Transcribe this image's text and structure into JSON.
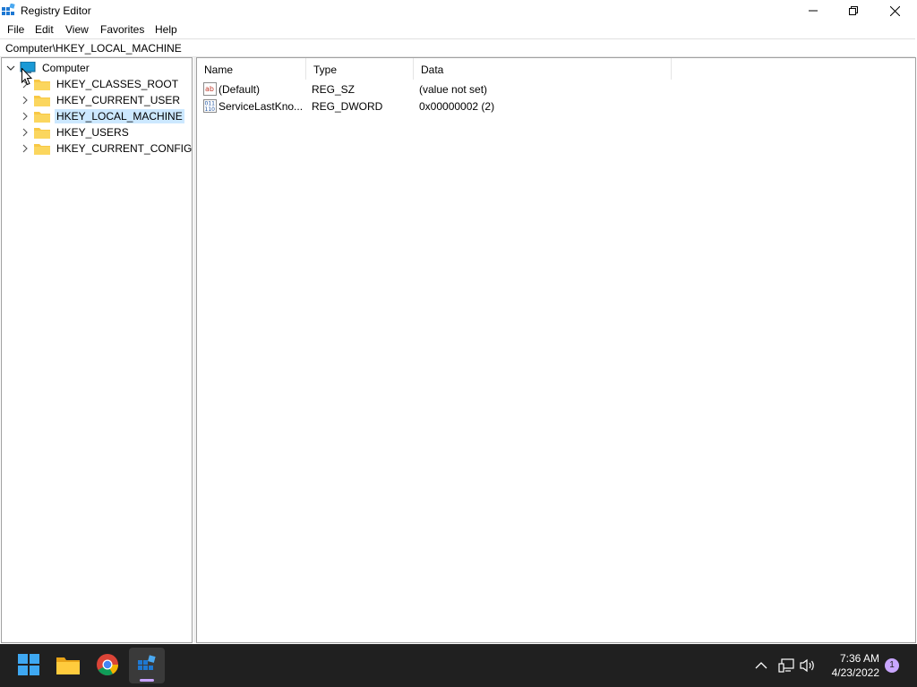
{
  "window": {
    "title": "Registry Editor"
  },
  "menu": [
    "File",
    "Edit",
    "View",
    "Favorites",
    "Help"
  ],
  "address": "Computer\\HKEY_LOCAL_MACHINE",
  "tree": {
    "root": "Computer",
    "items": [
      {
        "label": "HKEY_CLASSES_ROOT",
        "selected": false
      },
      {
        "label": "HKEY_CURRENT_USER",
        "selected": false
      },
      {
        "label": "HKEY_LOCAL_MACHINE",
        "selected": true
      },
      {
        "label": "HKEY_USERS",
        "selected": false
      },
      {
        "label": "HKEY_CURRENT_CONFIG",
        "selected": false
      }
    ]
  },
  "list": {
    "columns": [
      "Name",
      "Type",
      "Data"
    ],
    "rows": [
      {
        "icon": "string-value-icon",
        "name": "(Default)",
        "type": "REG_SZ",
        "data": "(value not set)"
      },
      {
        "icon": "binary-value-icon",
        "name": "ServiceLastKno...",
        "type": "REG_DWORD",
        "data": "0x00000002 (2)"
      }
    ]
  },
  "taskbar": {
    "apps": [
      "start-icon",
      "file-explorer-icon",
      "chrome-icon",
      "registry-editor-icon"
    ],
    "clock_time": "7:36 AM",
    "clock_date": "4/23/2022",
    "notification_count": "1"
  },
  "colors": {
    "selection": "#cce8ff",
    "taskbar": "#202020",
    "folder": "#f8c845",
    "active_indicator": "#c8a2ff"
  }
}
